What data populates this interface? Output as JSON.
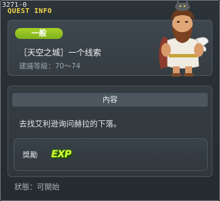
{
  "window": {
    "quest_id": "3271-0",
    "title": "QUEST INFO"
  },
  "header": {
    "category_badge": "一般",
    "quest_name": "［天空之城］一个线索",
    "recommended_level": "建議等級：70～74",
    "npc_portrait_icon": "bearded-man-with-cat-portrait-icon"
  },
  "body": {
    "section_header": "內容",
    "description": "去找艾利逊询问赫拉的下落。",
    "reward": {
      "label": "獎勵",
      "exp_icon_text": "EXP"
    }
  },
  "status": "狀態：可開始",
  "colors": {
    "title_yellow": "#f4d84a",
    "badge_green": "#8fc21f",
    "exp_green": "#d7ff3a"
  }
}
